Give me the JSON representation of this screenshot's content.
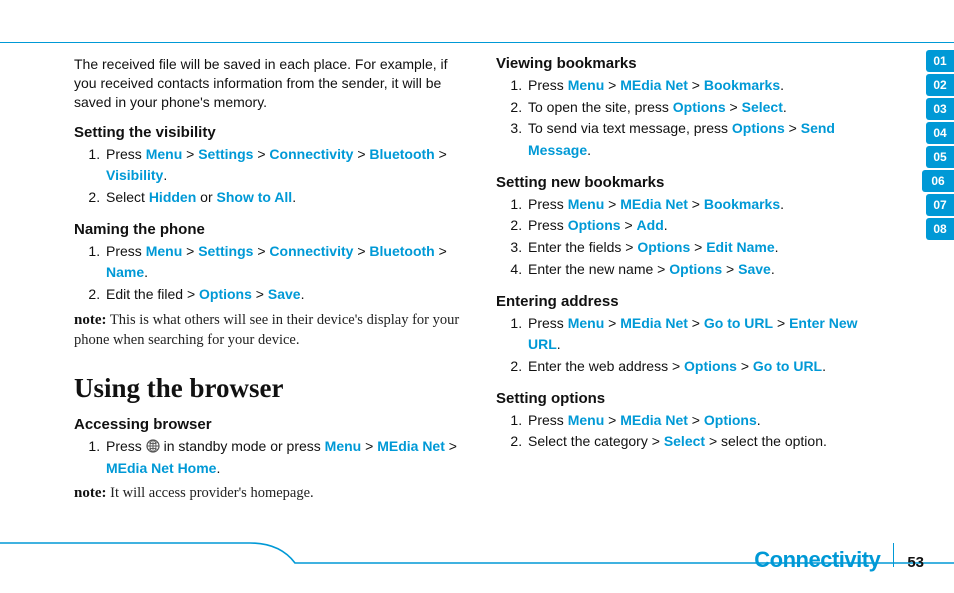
{
  "nav": {
    "items": [
      "01",
      "02",
      "03",
      "04",
      "05",
      "06",
      "07",
      "08"
    ],
    "active": "06"
  },
  "footer": {
    "section": "Connectivity",
    "page": "53"
  },
  "left": {
    "intro": "The received file will be saved in each place. For example, if you received contacts information from the sender, it will be saved in your phone's memory.",
    "s1": {
      "h": "Setting the visibility",
      "i1a": "Press ",
      "i1b": "Menu",
      "i1c": "Settings",
      "i1d": "Connectivity",
      "i1e": "Bluetooth",
      "i1f": "Visibility",
      "i2a": "Select ",
      "i2b": "Hidden",
      "i2c": " or ",
      "i2d": "Show to All"
    },
    "s2": {
      "h": "Naming the phone",
      "i1a": "Press ",
      "i1b": "Menu",
      "i1c": "Settings",
      "i1d": "Connectivity",
      "i1e": "Bluetooth",
      "i1f": "Name",
      "i2a": "Edit the filed > ",
      "i2b": "Options",
      "i2c": "Save",
      "note_lbl": "note:",
      "note_body": " This is what others will see in their device's display for your phone when searching for your device."
    },
    "h1": "Using the browser",
    "s3": {
      "h": "Accessing browser",
      "i1a": "Press ",
      "i1b": " in standby mode or press ",
      "i1c": "Menu",
      "i1d": "MEdia Net",
      "i1e": "MEdia Net Home",
      "note_lbl": "note:",
      "note_body": " It will access provider's homepage."
    }
  },
  "right": {
    "s1": {
      "h": "Viewing bookmarks",
      "i1a": "Press ",
      "i1b": "Menu",
      "i1c": "MEdia Net",
      "i1d": "Bookmarks",
      "i2a": "To open the site, press ",
      "i2b": "Options",
      "i2c": "Select",
      "i3a": "To send via text message, press ",
      "i3b": "Options",
      "i3c": "Send Message"
    },
    "s2": {
      "h": "Setting new bookmarks",
      "i1a": "Press ",
      "i1b": "Menu",
      "i1c": "MEdia Net",
      "i1d": "Bookmarks",
      "i2a": "Press ",
      "i2b": "Options",
      "i2c": "Add",
      "i3a": "Enter the fields > ",
      "i3b": "Options",
      "i3c": "Edit Name",
      "i4a": "Enter the new name > ",
      "i4b": "Options",
      "i4c": "Save"
    },
    "s3": {
      "h": "Entering address",
      "i1a": "Press ",
      "i1b": "Menu",
      "i1c": "MEdia Net",
      "i1d": "Go to URL",
      "i1e": "Enter New URL",
      "i2a": "Enter the web address > ",
      "i2b": "Options",
      "i2c": "Go to URL"
    },
    "s4": {
      "h": "Setting options",
      "i1a": "Press ",
      "i1b": "Menu",
      "i1c": "MEdia Net",
      "i1d": "Options",
      "i2a": "Select the category > ",
      "i2b": "Select",
      "i2c": " > select the option."
    }
  },
  "sep": " > ",
  "dot": "."
}
